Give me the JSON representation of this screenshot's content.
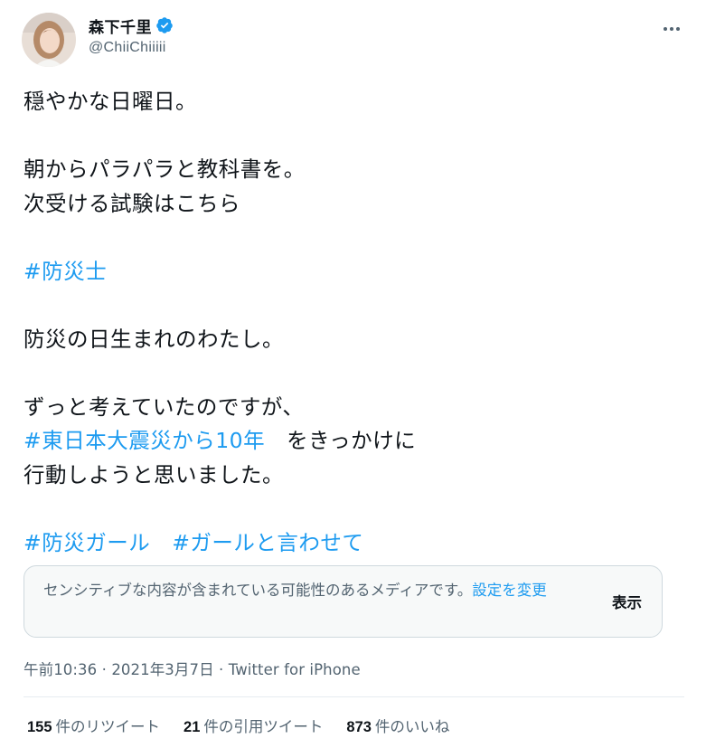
{
  "author": {
    "display_name": "森下千里",
    "handle": "@ChiiChiiiii",
    "verified": true
  },
  "tweet_lines": [
    [
      {
        "text": "穏やかな日曜日。",
        "link": false
      }
    ],
    [],
    [
      {
        "text": "朝からパラパラと教科書を。",
        "link": false
      }
    ],
    [
      {
        "text": "次受ける試験はこちら",
        "link": false
      }
    ],
    [],
    [
      {
        "text": "#防災士",
        "link": true
      }
    ],
    [],
    [
      {
        "text": "防災の日生まれのわたし。",
        "link": false
      }
    ],
    [],
    [
      {
        "text": "ずっと考えていたのですが、",
        "link": false
      }
    ],
    [
      {
        "text": "#東日本大震災から10年",
        "link": true
      },
      {
        "text": "　をきっかけに",
        "link": false
      }
    ],
    [
      {
        "text": "行動しようと思いました。",
        "link": false
      }
    ],
    [],
    [
      {
        "text": "#防災ガール",
        "link": true
      },
      {
        "text": "　",
        "link": false
      },
      {
        "text": "#ガールと言わせて",
        "link": true
      }
    ]
  ],
  "sensitive_notice": {
    "message": "センシティブな内容が含まれている可能性のあるメディアです。",
    "settings_link": "設定を変更",
    "show_button": "表示"
  },
  "meta": {
    "time": "午前10:36",
    "date": "2021年3月7日",
    "separator": " · ",
    "source": "Twitter for iPhone"
  },
  "stats": [
    {
      "count": "155",
      "label": "件のリツイート"
    },
    {
      "count": "21",
      "label": "件の引用ツイート"
    },
    {
      "count": "873",
      "label": "件のいいね"
    }
  ],
  "colors": {
    "link": "#1d9bf0",
    "text": "#0f1419",
    "secondary": "#536471",
    "verified": "#1d9bf0"
  },
  "icons": {
    "verified": "verified-badge-icon",
    "more": "more-options-icon"
  }
}
